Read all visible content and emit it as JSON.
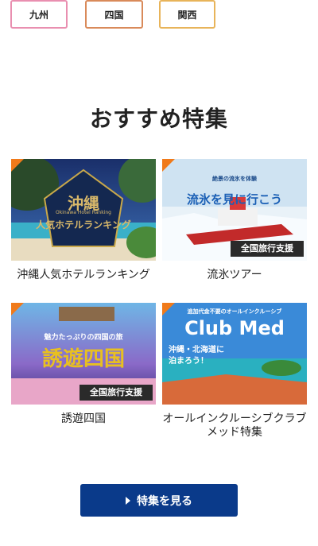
{
  "regions": [
    {
      "label": "九州",
      "color": "#e98fb0"
    },
    {
      "label": "四国",
      "color": "#d98a5a"
    },
    {
      "label": "関西",
      "color": "#e8b45a"
    }
  ],
  "section_title": "おすすめ特集",
  "features": [
    {
      "caption": "沖縄人気ホテルランキング",
      "image_text": {
        "title": "沖縄",
        "subtitle": "Okinawa Hotel Ranking",
        "line2": "人気ホテルランキング"
      }
    },
    {
      "caption": "流氷ツアー",
      "image_text": {
        "small": "絶景の流氷を体験",
        "title": "流氷を見に行こう",
        "badge": "全国旅行支援"
      }
    },
    {
      "caption": "誘遊四国",
      "image_text": {
        "small": "魅力たっぷりの四国の旅",
        "title": "誘遊四国",
        "badge": "全国旅行支援"
      }
    },
    {
      "caption": "オールインクルーシブクラブメッド特集",
      "image_text": {
        "small": "追加代金不要のオールインクルーシブ",
        "title": "Club Med",
        "line2": "沖縄・北海道に",
        "line3": "泊まろう！"
      }
    }
  ],
  "cta_label": "特集を見る",
  "colors": {
    "accent_orange": "#f07a1a",
    "cta_blue": "#0a3a8a"
  }
}
